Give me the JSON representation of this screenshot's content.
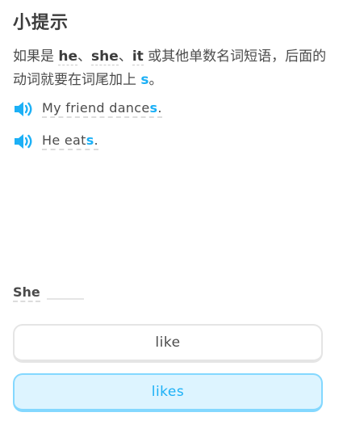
{
  "header": {
    "title": "小提示"
  },
  "tip": {
    "prefix": "如果是 ",
    "w1": "he",
    "sep1": "、",
    "w2": "she",
    "sep2": "、",
    "w3": "it",
    "middle": " 或其他单数名词短语，后面的动词就要在词尾加上 ",
    "suffix_letter": "s",
    "end": "。"
  },
  "examples": [
    {
      "base": "My friend dance",
      "suffix": "s",
      "end": "."
    },
    {
      "base": "He eat",
      "suffix": "s",
      "end": "."
    }
  ],
  "prompt": {
    "word": "She"
  },
  "choices": [
    {
      "label": "like",
      "state": "default"
    },
    {
      "label": "likes",
      "state": "selected"
    }
  ],
  "colors": {
    "accent": "#1cb0f6",
    "selected_bg": "#ddf4ff",
    "selected_border": "#84d8ff"
  }
}
